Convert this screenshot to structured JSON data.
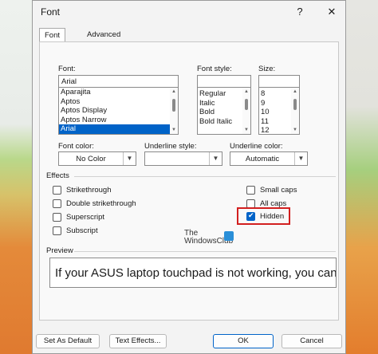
{
  "dialog": {
    "title": "Font",
    "help": "?",
    "close": "✕"
  },
  "tabs": [
    {
      "label": "Font",
      "active": true
    },
    {
      "label": "Advanced",
      "active": false
    }
  ],
  "font": {
    "label": "Font:",
    "value": "Arial",
    "list": [
      "Aparajita",
      "Aptos",
      "Aptos Display",
      "Aptos Narrow",
      "Arial"
    ],
    "selected": "Arial"
  },
  "style": {
    "label": "Font style:",
    "value": "",
    "list": [
      "Regular",
      "Italic",
      "Bold",
      "Bold Italic"
    ]
  },
  "size": {
    "label": "Size:",
    "value": "",
    "list": [
      "8",
      "9",
      "10",
      "11",
      "12"
    ]
  },
  "font_color": {
    "label": "Font color:",
    "value": "No Color"
  },
  "underline_style": {
    "label": "Underline style:",
    "value": ""
  },
  "underline_color": {
    "label": "Underline color:",
    "value": "Automatic"
  },
  "effects": {
    "label": "Effects",
    "left": [
      {
        "label": "Strikethrough",
        "checked": false
      },
      {
        "label": "Double strikethrough",
        "checked": false
      },
      {
        "label": "Superscript",
        "checked": false
      },
      {
        "label": "Subscript",
        "checked": false
      }
    ],
    "right": [
      {
        "label": "Small caps",
        "checked": false
      },
      {
        "label": "All caps",
        "checked": false
      },
      {
        "label": "Hidden",
        "checked": true
      }
    ]
  },
  "watermark": {
    "line1": "The",
    "line2": "WindowsClub"
  },
  "preview": {
    "label": "Preview",
    "text": "If your ASUS laptop touchpad is not working, you can use th"
  },
  "buttons": {
    "set_default": "Set As Default",
    "text_effects": "Text Effects...",
    "ok": "OK",
    "cancel": "Cancel"
  },
  "colors": {
    "accent": "#0063c8",
    "highlight": "#d21f1f"
  }
}
